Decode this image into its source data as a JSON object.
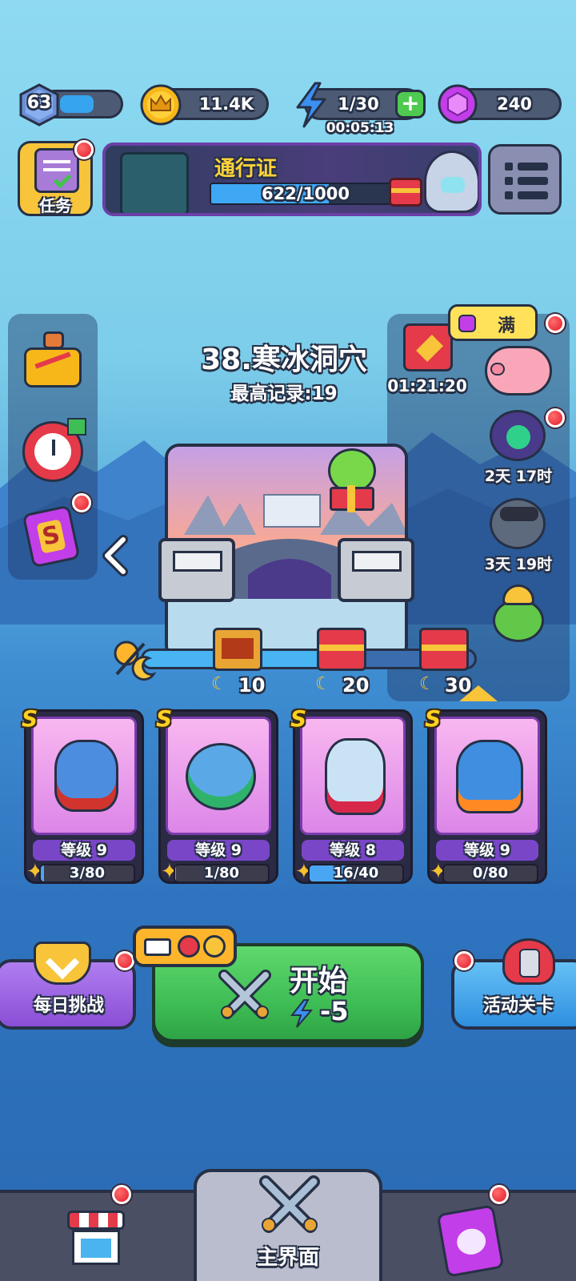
{
  "topbar": {
    "level": "63",
    "level_progress": 0.55,
    "coins": "11.4K",
    "energy": "1/30",
    "energy_timer": "00:05:13",
    "gems": "240"
  },
  "tasks": {
    "label": "任务"
  },
  "battle_pass": {
    "title": "通行证",
    "progress_text": "622/1000",
    "progress": 0.622
  },
  "piggy_bank": {
    "label": "满"
  },
  "stage": {
    "title": "38.寒冰洞穴",
    "record": "最高记录:19"
  },
  "right_events": {
    "chest_timer": "01:21:20",
    "event1_timer": "2天 17时",
    "event2_timer": "3天 19时"
  },
  "milestones": [
    {
      "value": "10"
    },
    {
      "value": "20"
    },
    {
      "value": "30"
    }
  ],
  "cards": [
    {
      "rank": "S",
      "level": "等级 9",
      "progress_text": "3/80",
      "progress": 0.0375,
      "body": "#4d8de0",
      "accent": "#d0342c"
    },
    {
      "rank": "S",
      "level": "等级 9",
      "progress_text": "1/80",
      "progress": 0.0125,
      "body": "#5aa9e6",
      "accent": "#2fb36b"
    },
    {
      "rank": "S",
      "level": "等级 8",
      "progress_text": "16/40",
      "progress": 0.4,
      "body": "#c9e3f5",
      "accent": "#d8284a"
    },
    {
      "rank": "S",
      "level": "等级 9",
      "progress_text": "0/80",
      "progress": 0.0,
      "body": "#3f8ee0",
      "accent": "#ff8a24"
    }
  ],
  "actions": {
    "daily_challenge": "每日挑战",
    "start": "开始",
    "start_cost": "-5",
    "event_stage": "活动关卡"
  },
  "bottom_nav": {
    "main_label": "主界面"
  },
  "colors": {
    "start_green": "#3fbe55",
    "daily_purple": "#9a5ae0",
    "event_blue": "#3aa4ef",
    "gem_purple": "#c23ee8",
    "coin_gold": "#f7b719"
  }
}
